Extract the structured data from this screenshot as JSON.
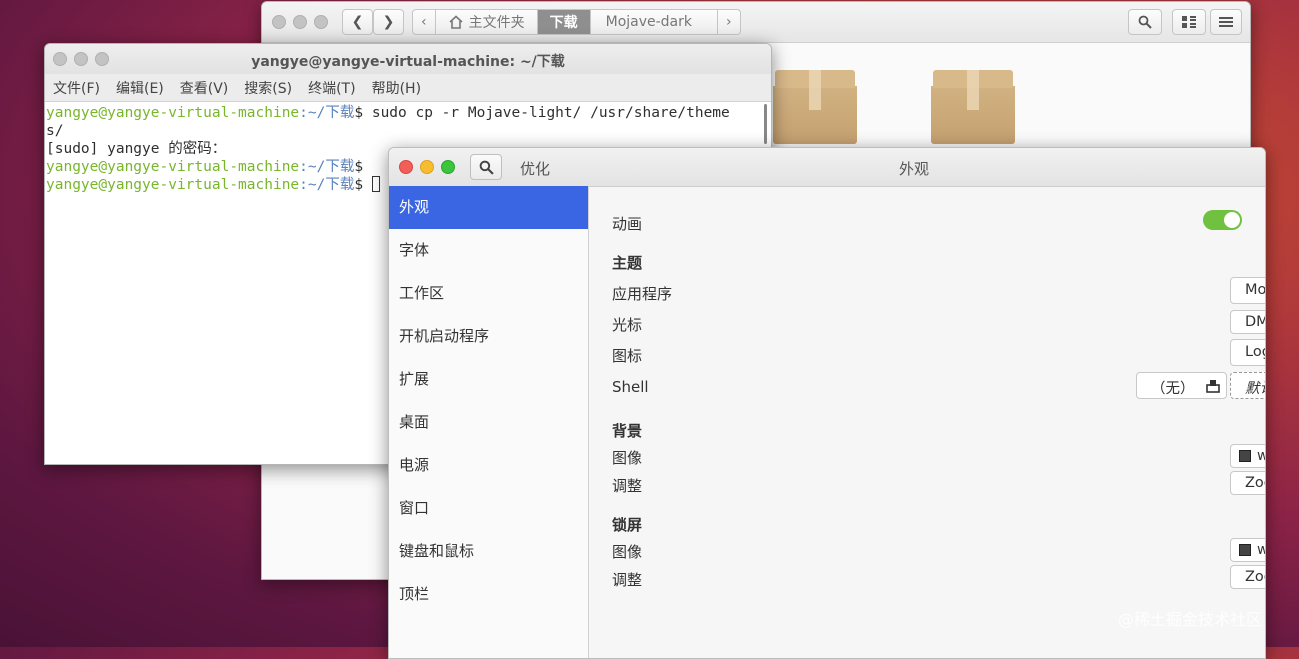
{
  "files": {
    "breadcrumbs": [
      "主文件夹",
      "下载",
      "Mojave-dark"
    ],
    "nav_back": "❮",
    "nav_forward": "❯",
    "crumb_left": "‹",
    "crumb_right": "›"
  },
  "terminal": {
    "title": "yangye@yangye-virtual-machine: ~/下载",
    "menu": [
      "文件(F)",
      "编辑(E)",
      "查看(V)",
      "搜索(S)",
      "终端(T)",
      "帮助(H)"
    ],
    "prompt_user": "yangye@yangye-virtual-machine",
    "prompt_path": ":~/下载",
    "prompt_sign": "$ ",
    "command1": "sudo cp -r Mojave-light/ /usr/share/theme",
    "command1_wrap": "s/",
    "sudo_prompt": "[sudo] yangye 的密码："
  },
  "tweaks": {
    "app_name": "优化",
    "page_title": "外观",
    "sidebar": [
      "外观",
      "字体",
      "工作区",
      "开机启动程序",
      "扩展",
      "桌面",
      "电源",
      "窗口",
      "键盘和鼠标",
      "顶栏"
    ],
    "animation_label": "动画",
    "animation_on": true,
    "theme_section": "主题",
    "app_label": "应用程序",
    "app_value": "Mojave-light",
    "cursor_label": "光标",
    "cursor_value": "DMZ-White",
    "icon_label": "图标",
    "icon_value": "LoginIcons",
    "shell_label": "Shell",
    "shell_none": "（无）",
    "shell_value": "默认",
    "bg_section": "背景",
    "bg_image_label": "图像",
    "bg_image_value": "warty-final-ubuntu.png",
    "bg_adjust_label": "调整",
    "bg_adjust_value": "Zoom",
    "lock_section": "锁屏",
    "lock_image_label": "图像",
    "lock_image_value": "warty-final-ubuntu.png",
    "lock_adjust_label": "调整",
    "lock_adjust_value": "Zoom"
  },
  "colors": {
    "accent": "#3b66e3",
    "switch_on": "#6fc13f",
    "prompt_user": "#78b62c",
    "prompt_path": "#5a82bd"
  },
  "watermark": "@稀土掘金技术社区"
}
